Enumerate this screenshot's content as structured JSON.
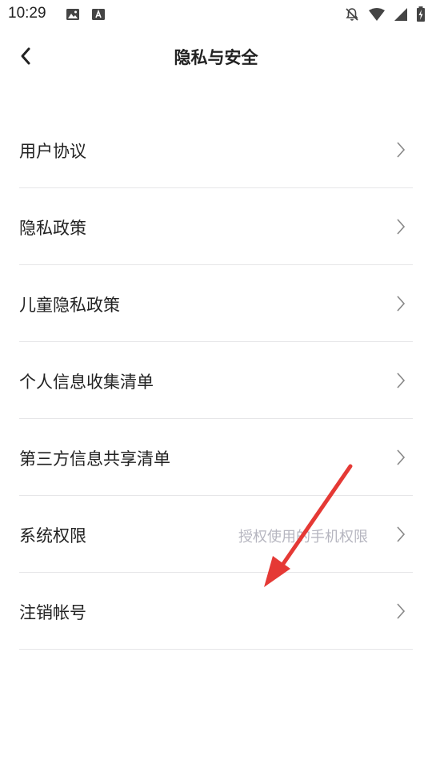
{
  "status_bar": {
    "time": "10:29"
  },
  "header": {
    "title": "隐私与安全"
  },
  "menu": {
    "items": [
      {
        "label": "用户协议",
        "sub": ""
      },
      {
        "label": "隐私政策",
        "sub": ""
      },
      {
        "label": "儿童隐私政策",
        "sub": ""
      },
      {
        "label": "个人信息收集清单",
        "sub": ""
      },
      {
        "label": "第三方信息共享清单",
        "sub": ""
      },
      {
        "label": "系统权限",
        "sub": "授权使用的手机权限"
      },
      {
        "label": "注销帐号",
        "sub": ""
      }
    ]
  },
  "colors": {
    "annotation_arrow": "#e53935",
    "divider": "#e6e6e8",
    "secondary_text": "#b6b6c0"
  },
  "icons": {
    "back": "chevron-left-icon",
    "row": "chevron-right-icon"
  }
}
